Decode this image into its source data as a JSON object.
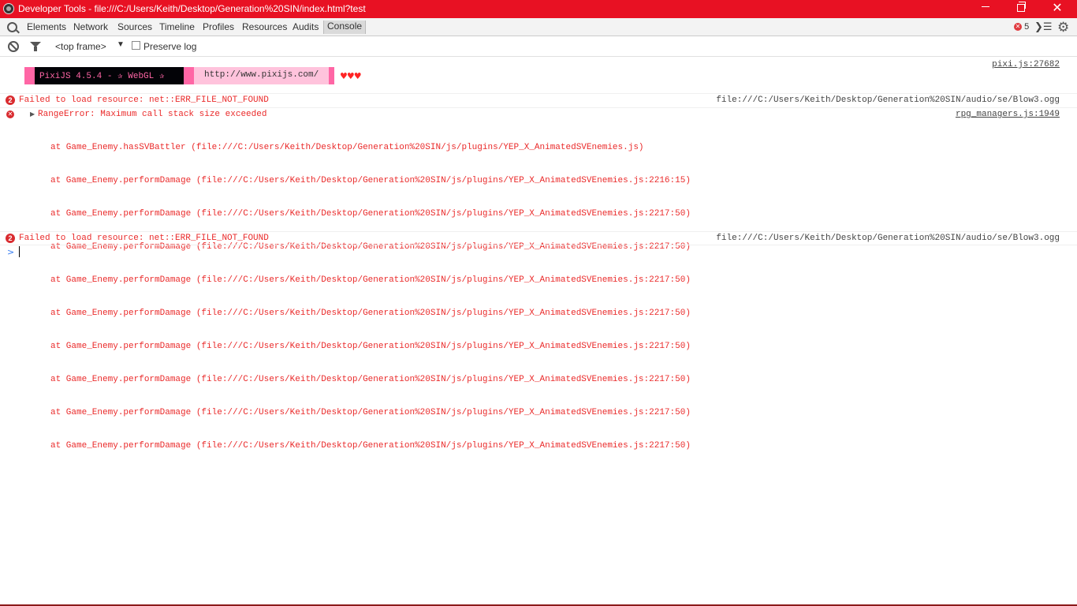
{
  "window": {
    "title": "Developer Tools - file:///C:/Users/Keith/Desktop/Generation%20SIN/index.html?test",
    "titlebar_color": "#e81123"
  },
  "tabs": {
    "items": [
      "Elements",
      "Network",
      "Sources",
      "Timeline",
      "Profiles",
      "Resources",
      "Audits",
      "Console"
    ],
    "selected": "Console",
    "error_count": "5"
  },
  "console_toolbar": {
    "frame": "<top frame>",
    "preserve_log_label": "Preserve log",
    "preserve_log_checked": false
  },
  "messages": {
    "pixi": {
      "banner_left": "PixiJS 4.5.4 - ✰ WebGL ✰",
      "banner_url": "http://www.pixijs.com/",
      "hearts": "♥♥♥",
      "source": "pixi.js:27682"
    },
    "error1": {
      "count": "2",
      "text": "Failed to load resource: net::ERR_FILE_NOT_FOUND",
      "source": "file:///C:/Users/Keith/Desktop/Generation%20SIN/audio/se/Blow3.ogg"
    },
    "range_error": {
      "text": "RangeError: Maximum call stack size exceeded",
      "source": "rpg_managers.js:1949",
      "stack": [
        "at Game_Enemy.hasSVBattler (file:///C:/Users/Keith/Desktop/Generation%20SIN/js/plugins/YEP_X_AnimatedSVEnemies.js)",
        "at Game_Enemy.performDamage (file:///C:/Users/Keith/Desktop/Generation%20SIN/js/plugins/YEP_X_AnimatedSVEnemies.js:2216:15)",
        "at Game_Enemy.performDamage (file:///C:/Users/Keith/Desktop/Generation%20SIN/js/plugins/YEP_X_AnimatedSVEnemies.js:2217:50)",
        "at Game_Enemy.performDamage (file:///C:/Users/Keith/Desktop/Generation%20SIN/js/plugins/YEP_X_AnimatedSVEnemies.js:2217:50)",
        "at Game_Enemy.performDamage (file:///C:/Users/Keith/Desktop/Generation%20SIN/js/plugins/YEP_X_AnimatedSVEnemies.js:2217:50)",
        "at Game_Enemy.performDamage (file:///C:/Users/Keith/Desktop/Generation%20SIN/js/plugins/YEP_X_AnimatedSVEnemies.js:2217:50)",
        "at Game_Enemy.performDamage (file:///C:/Users/Keith/Desktop/Generation%20SIN/js/plugins/YEP_X_AnimatedSVEnemies.js:2217:50)",
        "at Game_Enemy.performDamage (file:///C:/Users/Keith/Desktop/Generation%20SIN/js/plugins/YEP_X_AnimatedSVEnemies.js:2217:50)",
        "at Game_Enemy.performDamage (file:///C:/Users/Keith/Desktop/Generation%20SIN/js/plugins/YEP_X_AnimatedSVEnemies.js:2217:50)",
        "at Game_Enemy.performDamage (file:///C:/Users/Keith/Desktop/Generation%20SIN/js/plugins/YEP_X_AnimatedSVEnemies.js:2217:50)"
      ]
    },
    "error2": {
      "count": "2",
      "text": "Failed to load resource: net::ERR_FILE_NOT_FOUND",
      "source": "file:///C:/Users/Keith/Desktop/Generation%20SIN/audio/se/Blow3.ogg"
    },
    "prompt": ">"
  },
  "colors": {
    "error_text": "#ea2a2a",
    "pixi_pink": "#ff66a5",
    "pixi_light": "#ffc3dc",
    "prompt_blue": "#367cf1"
  }
}
